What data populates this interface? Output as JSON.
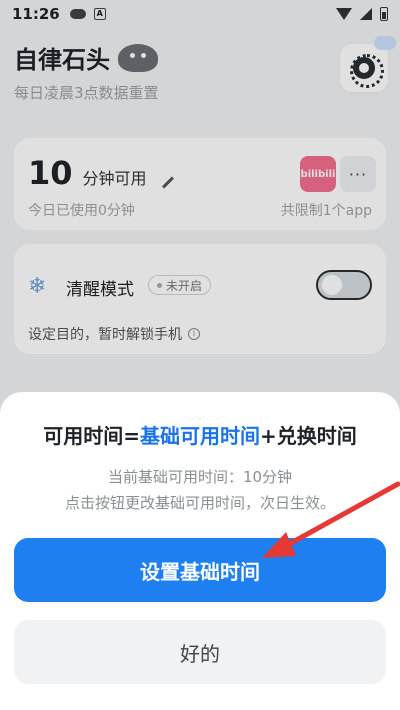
{
  "status_bar": {
    "time": "11:26",
    "icons": [
      "cloud-icon",
      "a-icon",
      "wifi-icon",
      "signal-icon",
      "battery-icon"
    ]
  },
  "header": {
    "title": "自律石头",
    "subtitle": "每日凌晨3点数据重置"
  },
  "card_time": {
    "minutes": "10",
    "unit": "分钟可用",
    "used": "今日已使用0分钟",
    "app_icon_label": "bilibili",
    "more_label": "···",
    "limit": "共限制1个app"
  },
  "card_mode": {
    "title": "清醒模式",
    "badge": "未开启",
    "description": "设定目的，暂时解锁手机",
    "toggle_on": false
  },
  "sheet": {
    "title_prefix": "可用时间=",
    "title_highlight": "基础可用时间",
    "title_suffix": "+兑换时间",
    "line1": "当前基础可用时间：10分钟",
    "line2": "点击按钮更改基础可用时间，次日生效。",
    "primary_button": "设置基础时间",
    "secondary_button": "好的"
  },
  "colors": {
    "accent": "#1e7ff0",
    "highlight": "#1a73e8",
    "annotation": "#e53935"
  }
}
